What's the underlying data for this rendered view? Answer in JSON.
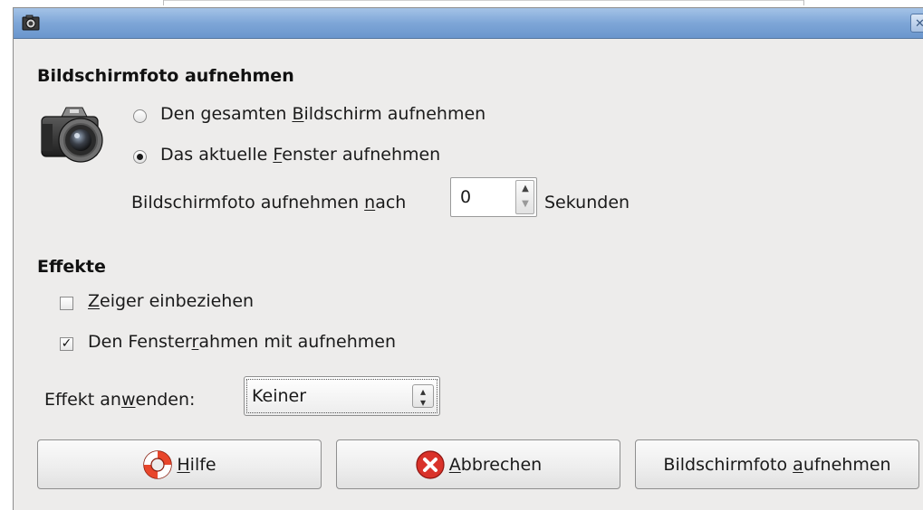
{
  "dialog": {
    "capture_section": {
      "title": "Bildschirmfoto aufnehmen",
      "option_whole_screen": {
        "pre": "Den gesamten ",
        "key": "B",
        "post": "ildschirm aufnehmen",
        "selected": false
      },
      "option_current_window": {
        "pre": "Das aktuelle ",
        "key": "F",
        "post": "enster aufnehmen",
        "selected": true
      },
      "delay": {
        "pre": "Bildschirmfoto aufnehmen ",
        "key": "n",
        "post": "ach",
        "value": "0",
        "unit": "Sekunden"
      }
    },
    "effects_section": {
      "title": "Effekte",
      "include_pointer": {
        "pre": "",
        "key": "Z",
        "post": "eiger einbeziehen",
        "checked": false
      },
      "include_border": {
        "pre": "Den Fenster",
        "key": "r",
        "post": "ahmen mit aufnehmen",
        "checked": true
      },
      "apply_effect": {
        "pre": "Effekt an",
        "key": "w",
        "post": "enden:",
        "selected": "Keiner"
      }
    },
    "buttons": {
      "help": {
        "pre": "",
        "key": "H",
        "post": "ilfe",
        "icon": "help-lifebuoy-icon"
      },
      "cancel": {
        "pre": "",
        "key": "A",
        "post": "bbrechen",
        "icon": "cancel-icon"
      },
      "take": {
        "pre": "Bildschirmfoto ",
        "key": "a",
        "post": "ufnehmen"
      }
    }
  },
  "colors": {
    "titlebar": "#7ea6d7",
    "window_bg": "#edeceb",
    "cancel_icon": "#d9322a",
    "help_icon": "#e8462b"
  }
}
